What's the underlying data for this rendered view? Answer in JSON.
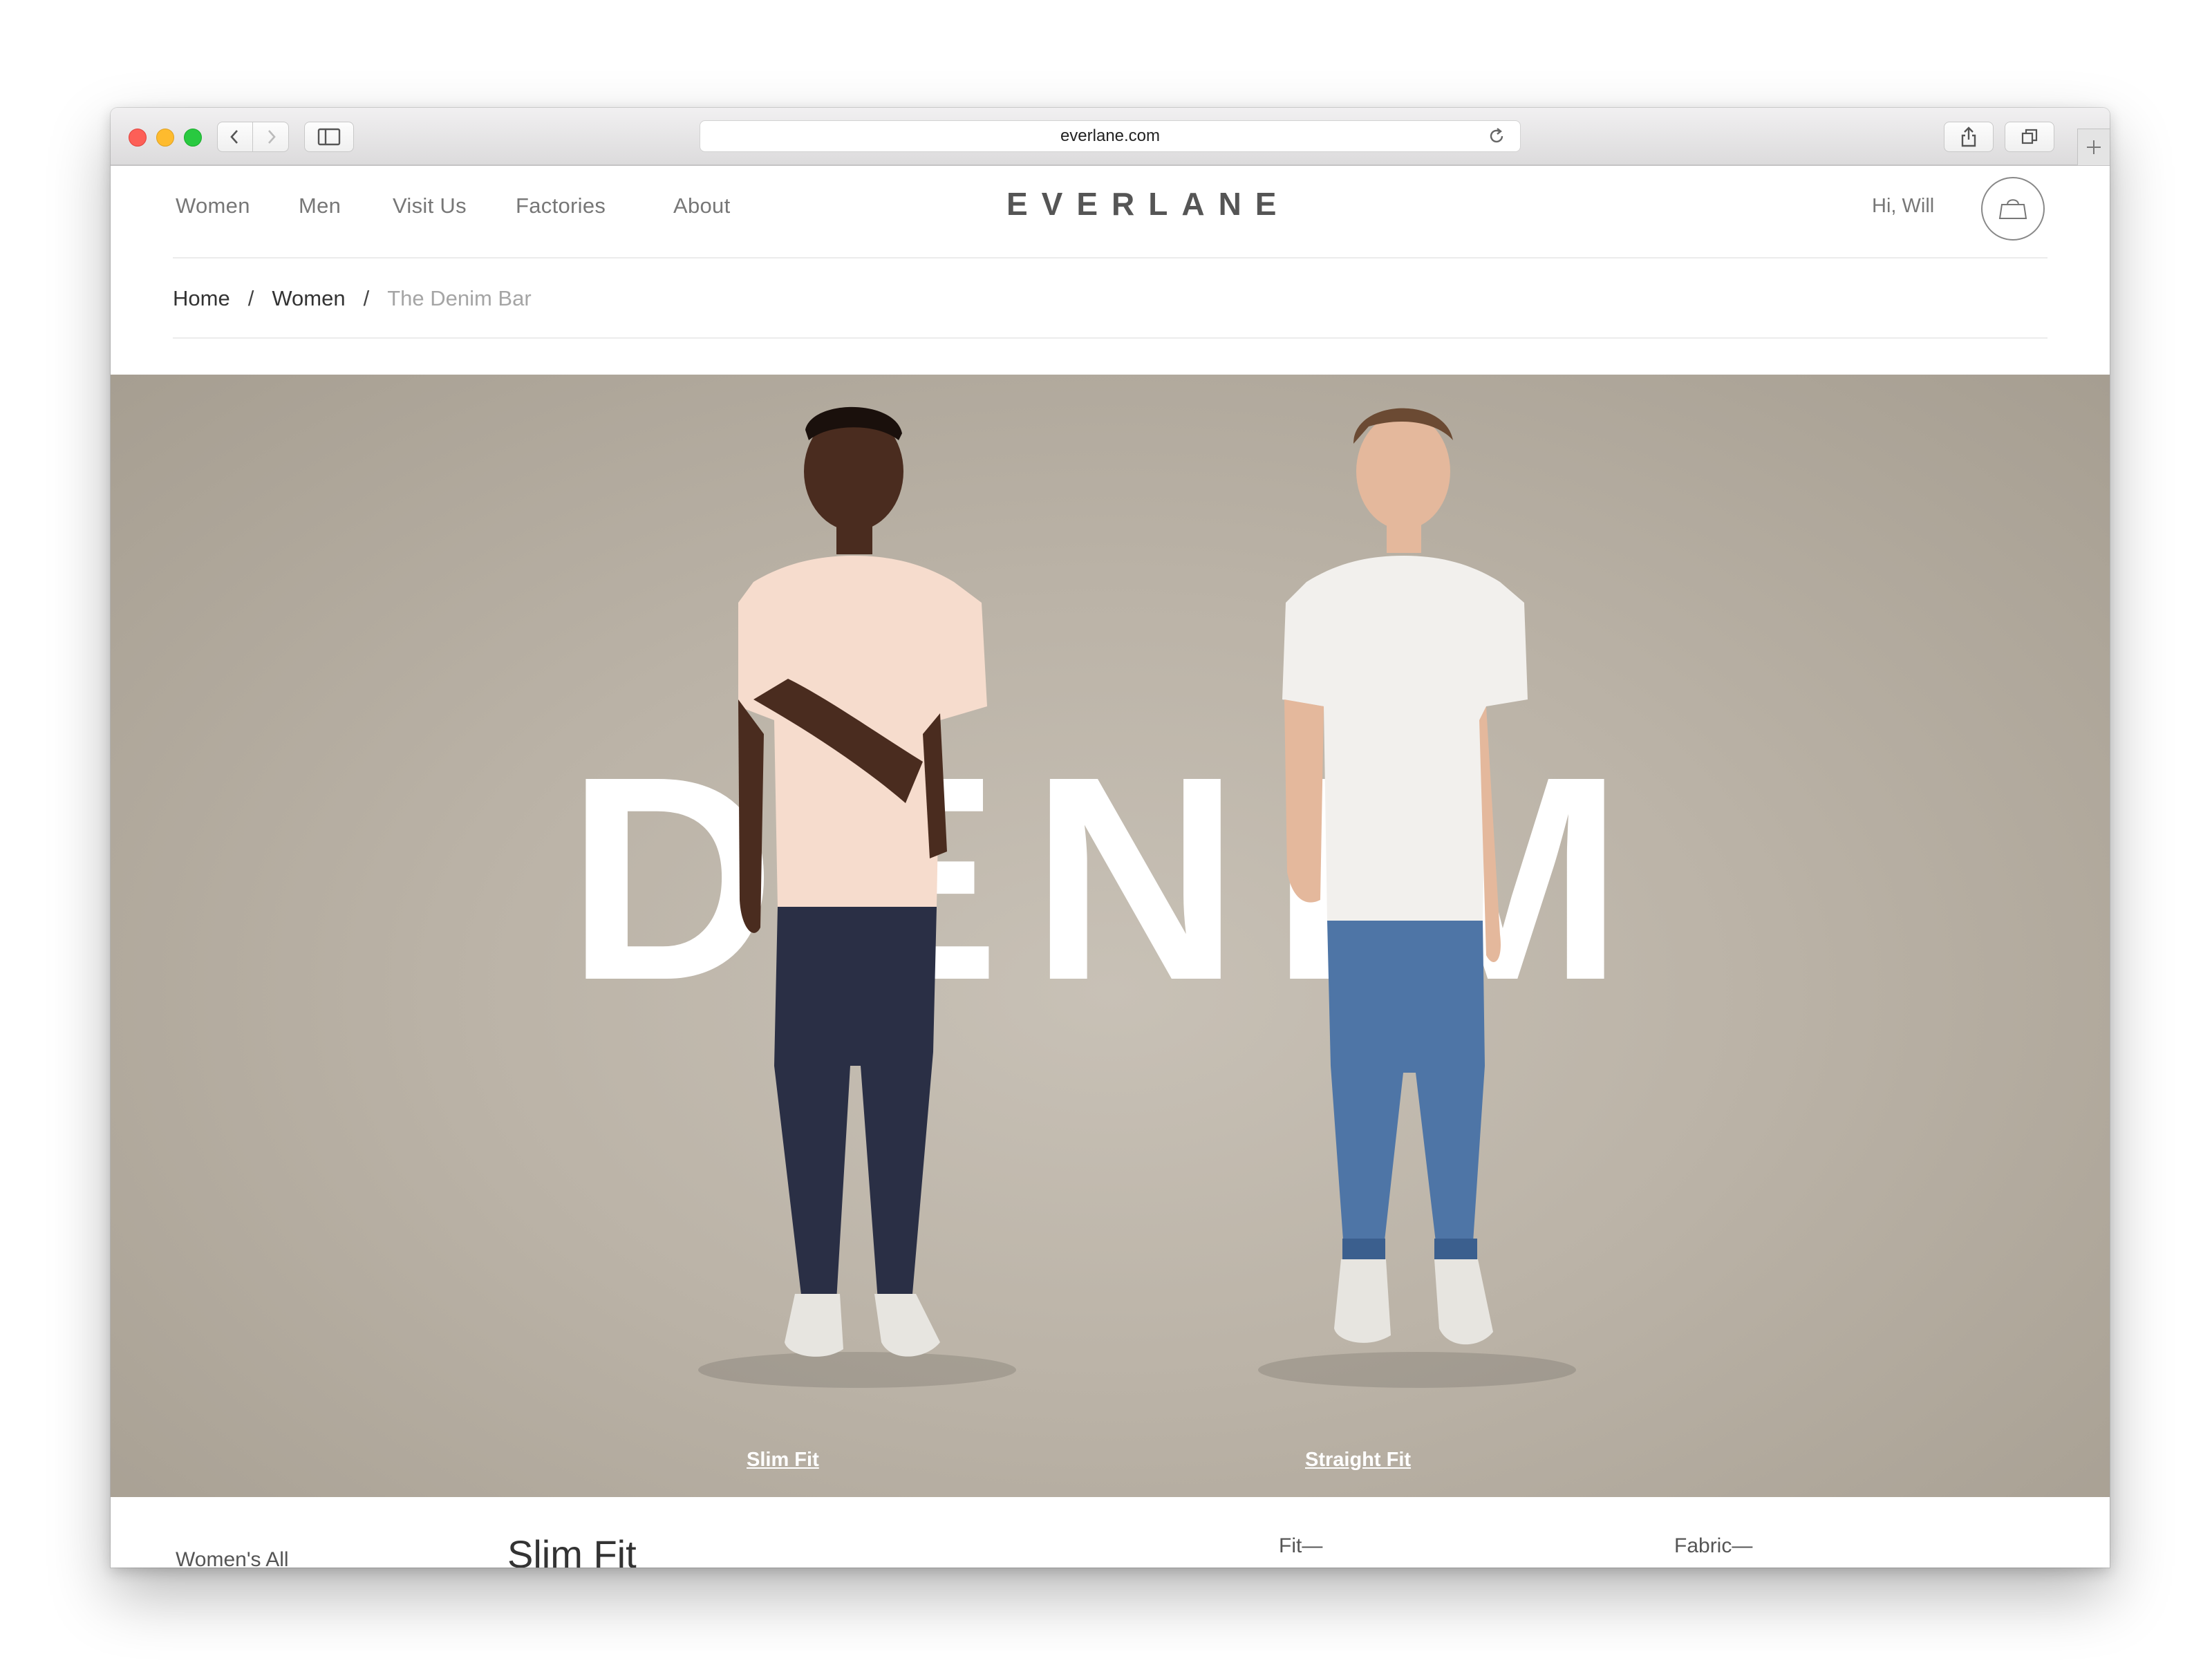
{
  "browser": {
    "url": "everlane.com"
  },
  "site": {
    "brand": "EVERLANE",
    "nav": [
      "Women",
      "Men",
      "Visit Us",
      "Factories",
      "About"
    ],
    "greeting": "Hi, Will"
  },
  "breadcrumb": {
    "home": "Home",
    "section": "Women",
    "current": "The Denim Bar"
  },
  "hero": {
    "word": "DENIM",
    "links": [
      "Slim Fit",
      "Straight Fit"
    ]
  },
  "below": {
    "sidebar_label": "Women's All",
    "section_title": "Slim Fit",
    "fit_label": "Fit—",
    "fabric_label": "Fabric—"
  },
  "colors": {
    "hero_bg": "#bbb3a7",
    "text_primary": "#333333",
    "text_muted": "#a5a5a5"
  }
}
